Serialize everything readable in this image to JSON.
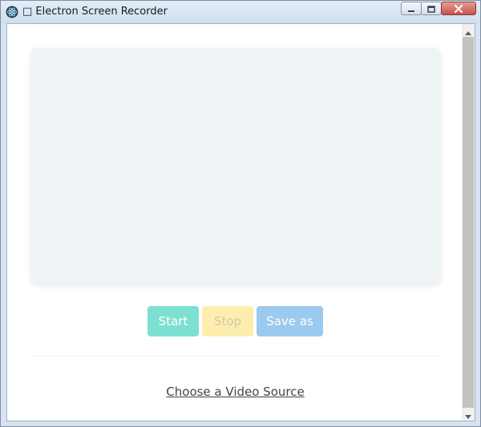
{
  "window": {
    "title": "□ Electron Screen Recorder"
  },
  "controls": {
    "start_label": "Start",
    "stop_label": "Stop",
    "save_label": "Save as"
  },
  "source": {
    "link_label": "Choose a Video Source"
  },
  "colors": {
    "start": "#7ee0d1",
    "stop": "#fdeeb0",
    "save": "#9cc9ee",
    "preview": "#eef3f5"
  },
  "icons": {
    "app": "electron-atom-icon",
    "minimize": "minimize-icon",
    "maximize": "maximize-icon",
    "close": "close-icon"
  }
}
